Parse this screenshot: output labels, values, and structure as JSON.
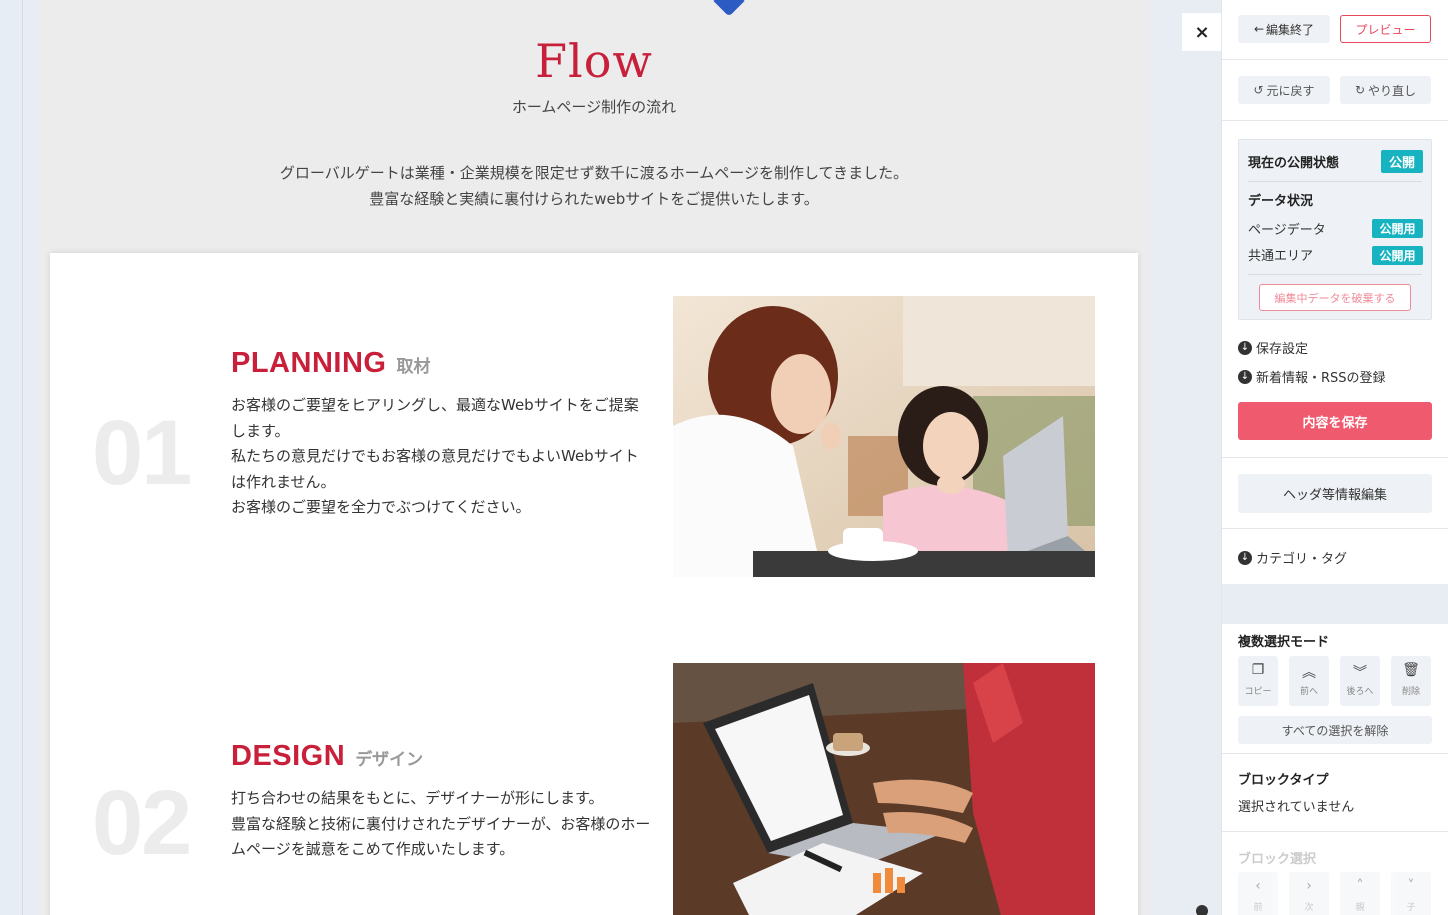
{
  "preview": {
    "title": "Flow",
    "subtitle": "ホームページ制作の流れ",
    "intro_line1": "グローバルゲートは業種・企業規模を限定せず数千に渡るホームページを制作してきました。",
    "intro_line2": "豊富な経験と実績に裏付けられたwebサイトをご提供いたします。",
    "steps": [
      {
        "number": "01",
        "title": "PLANNING",
        "subtitle": "取材",
        "text": "お客様のご要望をヒアリングし、最適なWebサイトをご提案します。\n私たちの意見だけでもお客様の意見だけでもよいWebサイトは作れません。\nお客様のご要望を全力でぶつけてください。"
      },
      {
        "number": "02",
        "title": "DESIGN",
        "subtitle": "デザイン",
        "text": "打ち合わせの結果をもとに、デザイナーが形にします。\n豊富な経験と技術に裏付けされたデザイナーが、お客様のホームページを誠意をこめて作成いたします。"
      }
    ]
  },
  "panel": {
    "close_icon": "×",
    "end_edit_label": "編集終了",
    "preview_label": "プレビュー",
    "undo_label": "元に戻す",
    "redo_label": "やり直し",
    "publish_state_label": "現在の公開状態",
    "publish_state_badge": "公開",
    "data_status_label": "データ状況",
    "page_data_label": "ページデータ",
    "page_data_badge": "公開用",
    "common_area_label": "共通エリア",
    "common_area_badge": "公開用",
    "discard_label": "編集中データを破棄する",
    "save_settings_label": "保存設定",
    "rss_label": "新着情報・RSSの登録",
    "save_content_label": "内容を保存",
    "header_edit_label": "ヘッダ等情報編集",
    "category_tag_label": "カテゴリ・タグ",
    "multi_select_title": "複数選択モード",
    "tools": [
      {
        "label": "コピー",
        "icon": "copy-icon"
      },
      {
        "label": "前へ",
        "icon": "double-chevron-up-icon"
      },
      {
        "label": "後ろへ",
        "icon": "double-chevron-down-icon"
      },
      {
        "label": "削除",
        "icon": "trash-icon"
      }
    ],
    "clear_selection_label": "すべての選択を解除",
    "block_type_title": "ブロックタイプ",
    "block_type_value": "選択されていません",
    "block_select_title": "ブロック選択",
    "block_select_tools": [
      "前",
      "次",
      "親",
      "子"
    ]
  },
  "colors": {
    "accent_red": "#c8203a",
    "save_button": "#f05a6e",
    "badge_teal": "#18b3c0",
    "pin_blue": "#2d5bc4"
  }
}
